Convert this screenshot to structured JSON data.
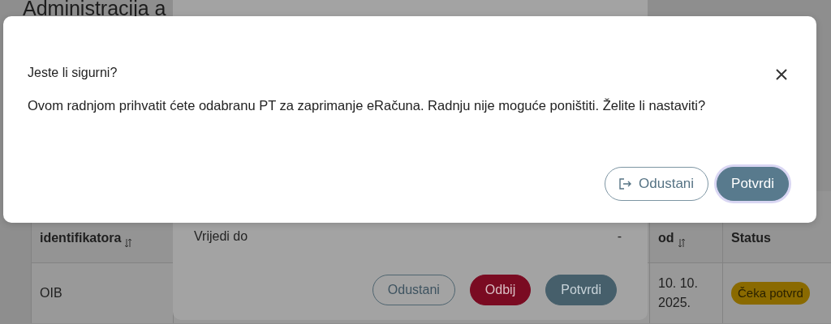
{
  "background_page": {
    "title": "Administracija a",
    "table": {
      "columns": [
        {
          "label": "identifikatora",
          "sortable": true
        },
        {
          "sortable": false
        },
        {
          "label": "od",
          "sortable": true
        },
        {
          "label": "Status",
          "sortable": false
        }
      ],
      "rows": [
        {
          "cells": [
            "OIB",
            "",
            "10. 10. 2025."
          ],
          "status": "Čeka potvrd"
        }
      ]
    }
  },
  "details_dialog": {
    "fields": [
      {
        "label": "Vrijedi do",
        "value": "-"
      }
    ],
    "buttons": [
      {
        "label": "Odustani",
        "kind": "outline"
      },
      {
        "label": "Odbij",
        "kind": "danger"
      },
      {
        "label": "Potvrdi",
        "kind": "primary"
      }
    ]
  },
  "confirm_dialog": {
    "title": "Jeste li sigurni?",
    "message": "Ovom radnjom prihvatit ćete odabranu PT za zaprimanje eRačuna. Radnju nije moguće poništiti. Želite li nastaviti?",
    "buttons": [
      {
        "label": "Odustani",
        "kind": "outline",
        "focused": false
      },
      {
        "label": "Potvrdi",
        "kind": "primary",
        "focused": true
      }
    ]
  }
}
